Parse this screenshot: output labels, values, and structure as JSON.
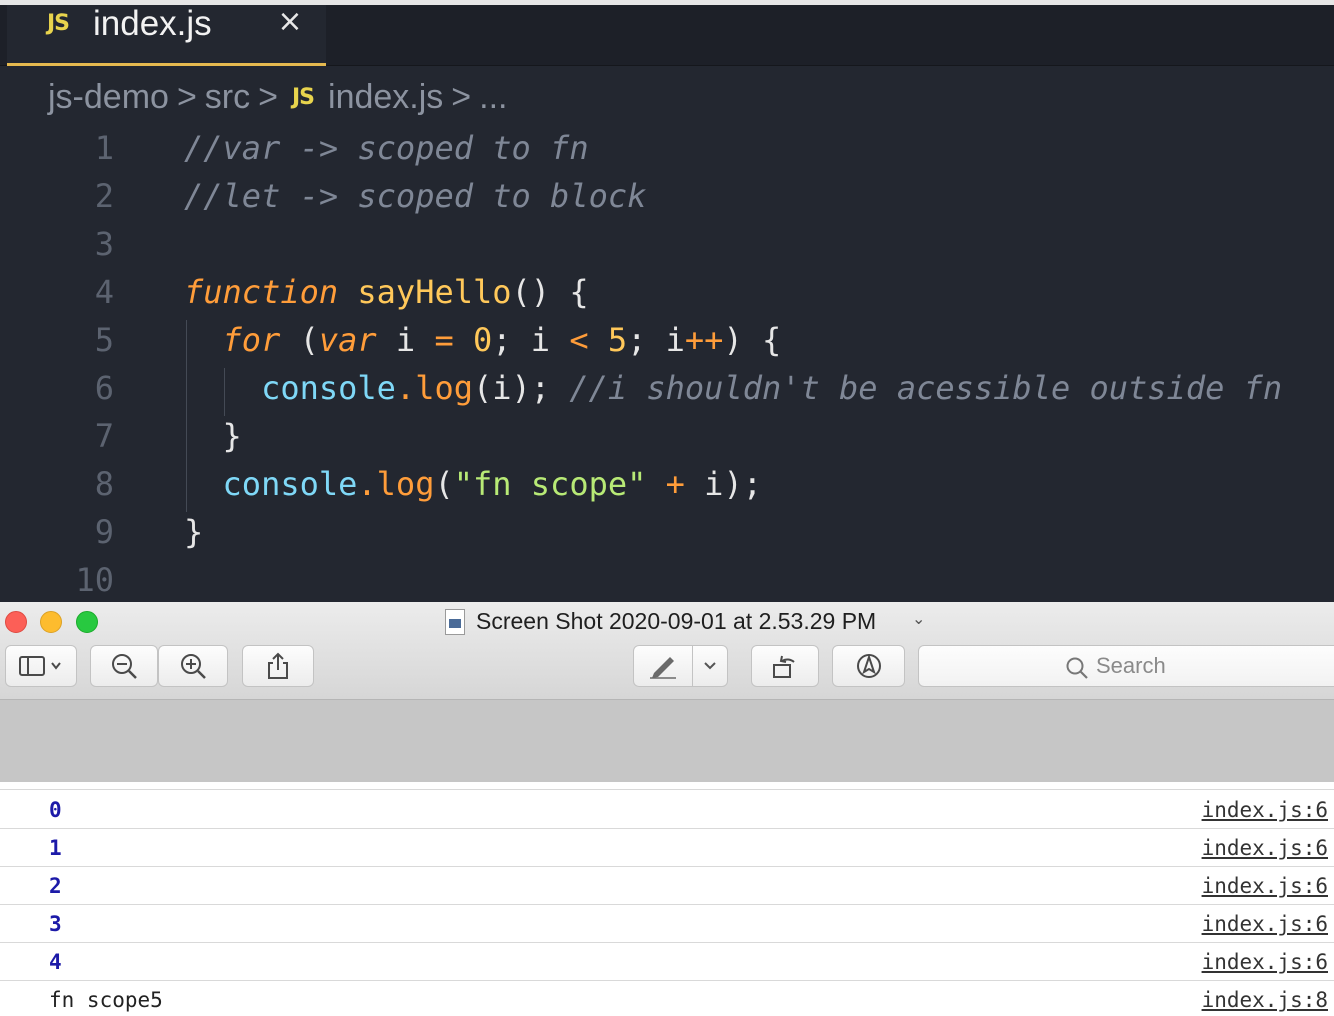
{
  "editor": {
    "tab": {
      "badge": "JS",
      "title": "index.js",
      "close": "×"
    },
    "breadcrumb": [
      "js-demo",
      "src",
      "index.js",
      "..."
    ],
    "breadcrumb_badge": "JS",
    "breadcrumb_sep": ">",
    "lines": [
      {
        "n": "1",
        "tokens": [
          {
            "t": "//var -> scoped to fn",
            "c": "cm"
          }
        ]
      },
      {
        "n": "2",
        "tokens": [
          {
            "t": "//let -> scoped to block",
            "c": "cm"
          }
        ]
      },
      {
        "n": "3",
        "tokens": []
      },
      {
        "n": "4",
        "tokens": [
          {
            "t": "function",
            "c": "kw"
          },
          {
            "t": " "
          },
          {
            "t": "sayHello",
            "c": "fn"
          },
          {
            "t": "() {"
          }
        ]
      },
      {
        "n": "5",
        "tokens": [
          {
            "t": "  "
          },
          {
            "t": "for",
            "c": "kw"
          },
          {
            "t": " ("
          },
          {
            "t": "var",
            "c": "kw"
          },
          {
            "t": " i "
          },
          {
            "t": "=",
            "c": "op"
          },
          {
            "t": " "
          },
          {
            "t": "0",
            "c": "num"
          },
          {
            "t": "; i "
          },
          {
            "t": "<",
            "c": "op"
          },
          {
            "t": " "
          },
          {
            "t": "5",
            "c": "num"
          },
          {
            "t": "; i"
          },
          {
            "t": "++",
            "c": "op"
          },
          {
            "t": ") {"
          }
        ]
      },
      {
        "n": "6",
        "tokens": [
          {
            "t": "    "
          },
          {
            "t": "console",
            "c": "obj"
          },
          {
            "t": ".",
            "c": "op"
          },
          {
            "t": "log",
            "c": "meth"
          },
          {
            "t": "(i); "
          },
          {
            "t": "//i shouldn't be acessible outside fn",
            "c": "cm"
          }
        ]
      },
      {
        "n": "7",
        "tokens": [
          {
            "t": "  }"
          }
        ]
      },
      {
        "n": "8",
        "tokens": [
          {
            "t": "  "
          },
          {
            "t": "console",
            "c": "obj"
          },
          {
            "t": ".",
            "c": "op"
          },
          {
            "t": "log",
            "c": "meth"
          },
          {
            "t": "("
          },
          {
            "t": "\"fn scope\"",
            "c": "str"
          },
          {
            "t": " "
          },
          {
            "t": "+",
            "c": "op"
          },
          {
            "t": " i);"
          }
        ]
      },
      {
        "n": "9",
        "tokens": [
          {
            "t": "}"
          }
        ]
      },
      {
        "n": "10",
        "tokens": []
      }
    ]
  },
  "preview": {
    "window_title": "Screen Shot 2020-09-01 at 2.53.29 PM",
    "title_chevron": "⌄",
    "search_placeholder": "Search",
    "console_rows": [
      {
        "value": "0",
        "source": "index.js:6"
      },
      {
        "value": "1",
        "source": "index.js:6"
      },
      {
        "value": "2",
        "source": "index.js:6"
      },
      {
        "value": "3",
        "source": "index.js:6"
      },
      {
        "value": "4",
        "source": "index.js:6"
      },
      {
        "value": "fn scope5",
        "source": "index.js:8"
      }
    ]
  }
}
